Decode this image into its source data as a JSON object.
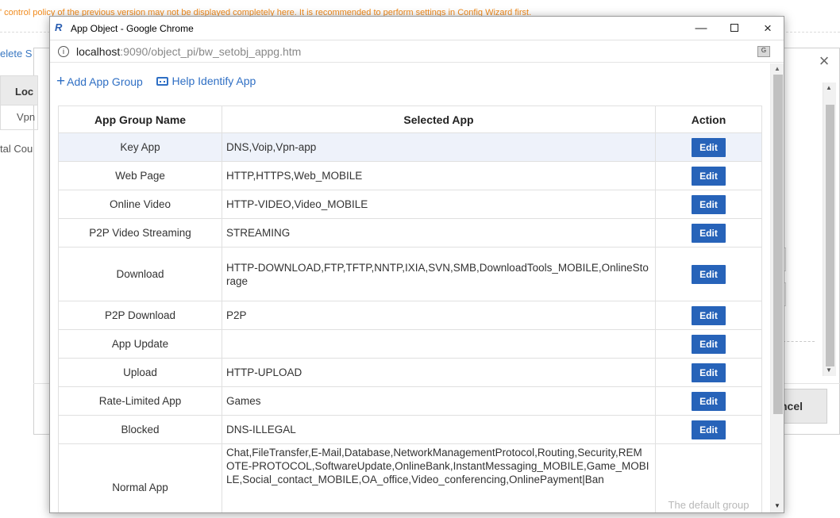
{
  "background": {
    "warning_text": "' control policy of the previous version may not be displayed completely here. It is recommended to perform settings in Config Wizard first.",
    "delete_partial": "elete S",
    "table_header_partial": "Loc",
    "row_partial": "Vpn",
    "total_partial": "tal Cou",
    "close_icon": "×",
    "cancel_partial": "ncel"
  },
  "window": {
    "title": "App Object - Google Chrome",
    "logo_glyph": "R",
    "minimize_glyph": "—",
    "close_glyph": "×"
  },
  "address": {
    "info_glyph": "i",
    "host": "localhost",
    "path": ":9090/object_pi/bw_setobj_appg.htm",
    "translate_glyph": "G"
  },
  "toolbar": {
    "add_label": "Add App Group",
    "help_label": "Help Identify App"
  },
  "table": {
    "headers": [
      "App Group Name",
      "Selected App",
      "Action"
    ],
    "edit_label": "Edit",
    "rows": [
      {
        "name": "Key App",
        "apps": "DNS,Voip,Vpn-app",
        "action": "Edit"
      },
      {
        "name": "Web Page",
        "apps": "HTTP,HTTPS,Web_MOBILE",
        "action": "Edit"
      },
      {
        "name": "Online Video",
        "apps": "HTTP-VIDEO,Video_MOBILE",
        "action": "Edit"
      },
      {
        "name": "P2P Video Streaming",
        "apps": "STREAMING",
        "action": "Edit"
      },
      {
        "name": "Download",
        "apps": "HTTP-DOWNLOAD,FTP,TFTP,NNTP,IXIA,SVN,SMB,DownloadTools_MOBILE,OnlineStorage",
        "action": "Edit"
      },
      {
        "name": "P2P Download",
        "apps": "P2P",
        "action": "Edit"
      },
      {
        "name": "App Update",
        "apps": "",
        "action": "Edit"
      },
      {
        "name": "Upload",
        "apps": "HTTP-UPLOAD",
        "action": "Edit"
      },
      {
        "name": "Rate-Limited App",
        "apps": "Games",
        "action": "Edit"
      },
      {
        "name": "Blocked",
        "apps": "DNS-ILLEGAL",
        "action": "Edit"
      },
      {
        "name": "Normal App",
        "apps": "Chat,FileTransfer,E-Mail,Database,NetworkManagementProtocol,Routing,Security,REMOTE-PROTOCOL,SoftwareUpdate,OnlineBank,InstantMessaging_MOBILE,Game_MOBILE,Social_contact_MOBILE,OA_office,Video_conferencing,OnlinePayment|Ban",
        "action": "The default group cannot be edited"
      }
    ]
  },
  "colors": {
    "accent": "#2763b9",
    "link": "#2f6fc4",
    "warning": "#f08a1c",
    "highlight_row": "#eef2fa"
  }
}
